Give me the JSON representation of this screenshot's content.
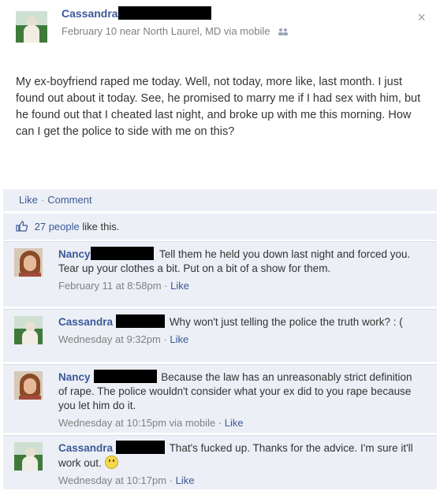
{
  "post": {
    "author": "Cassandra",
    "meta": "February 10 near North Laurel, MD via mobile",
    "close_glyph": "×",
    "text": "My ex-boyfriend raped me today. Well, not today, more like, last month. I just found out about it today. See, he promised to marry me if I had sex with him, but he found out that I cheated last night, and broke up with me this morning. How can I get the police to side with me on this?"
  },
  "actions": {
    "like": "Like",
    "sep": "·",
    "comment": "Comment"
  },
  "likes": {
    "count_text": "27 people",
    "suffix": " like this."
  },
  "comments": [
    {
      "name": "Nancy",
      "text": "Tell them he held you down last night and forced you. Tear up your clothes a bit. Put on a bit of a show for them.",
      "time": "February 11 at 8:58pm",
      "like": "Like"
    },
    {
      "name": "Cassandra",
      "text": "Why won't just telling the police the truth work? : (",
      "time": "Wednesday at 9:32pm",
      "like": "Like"
    },
    {
      "name": "Nancy",
      "text": "Because the law has an unreasonably strict definition of rape. The police wouldn't consider what your ex did to you rape because you let him do it.",
      "time": "Wednesday at 10:15pm via mobile",
      "like": "Like"
    },
    {
      "name": "Cassandra",
      "text": "That's fucked up. Thanks for the advice. I'm sure it'll work out.",
      "time": "Wednesday at 10:17pm",
      "like": "Like"
    }
  ],
  "colors": {
    "link": "#3b5998",
    "comment_bg": "#eceff5",
    "meta": "#808080"
  },
  "icons": [
    "people-icon",
    "thumbs-up-icon",
    "smiley-icon",
    "close-icon"
  ]
}
